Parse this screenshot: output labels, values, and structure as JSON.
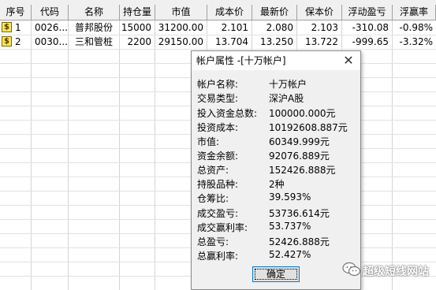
{
  "table": {
    "columns": [
      "序号",
      "代码",
      "名称",
      "持仓量",
      "市值",
      "成本价",
      "最新价",
      "保本价",
      "浮动盈亏",
      "浮赢率"
    ],
    "rows": [
      {
        "index": "1",
        "code": "0026...",
        "name": "普邦股份",
        "qty": "15000",
        "value": "31200.00",
        "cost": "2.101",
        "last": "2.080",
        "breakeven": "2.103",
        "pnl": "-310.08",
        "rate": "-0.98%"
      },
      {
        "index": "2",
        "code": "0030...",
        "name": "三和管桩",
        "qty": "2200",
        "value": "29150.00",
        "cost": "13.704",
        "last": "13.250",
        "breakeven": "13.722",
        "pnl": "-999.65",
        "rate": "-3.32%"
      }
    ],
    "row_icon": "$"
  },
  "dialog": {
    "title": "帐户属性 -[十万帐户]",
    "close_glyph": "✕",
    "props": [
      {
        "label": "帐户名称:",
        "value": "十万帐户"
      },
      {
        "label": "交易类型:",
        "value": "深沪A股"
      },
      {
        "label": "投入资金总数:",
        "value": "100000.000元"
      },
      {
        "label": "投资成本:",
        "value": "10192608.887元"
      },
      {
        "label": "市值:",
        "value": "60349.999元"
      },
      {
        "label": "资金余额:",
        "value": "92076.889元"
      },
      {
        "label": "总资产:",
        "value": "152426.888元"
      },
      {
        "label": "持股品种:",
        "value": "2种"
      },
      {
        "label": "仓筹比:",
        "value": "39.593%"
      },
      {
        "label": "成交盈亏:",
        "value": "53736.614元"
      },
      {
        "label": "成交赢利率:",
        "value": "53.737%"
      },
      {
        "label": "总盈亏:",
        "value": "52426.888元"
      },
      {
        "label": "总赢利率:",
        "value": "52.427%"
      }
    ],
    "ok_label": "确定"
  },
  "watermark": {
    "text": "超级短线网站",
    "icon": "wechat-icon"
  }
}
